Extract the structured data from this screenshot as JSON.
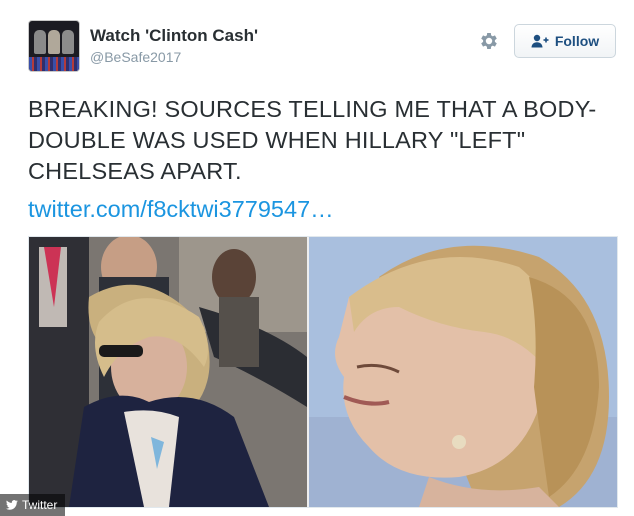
{
  "user": {
    "display_name": "Watch 'Clinton Cash'",
    "handle": "@BeSafe2017",
    "avatar_icon": "user-avatar"
  },
  "actions": {
    "follow_label": "Follow",
    "follow_icon": "person-plus-icon",
    "settings_icon": "gear-icon"
  },
  "tweet": {
    "text": "BREAKING! SOURCES TELLING ME THAT A BODY-DOUBLE WAS USED WHEN HILLARY \"LEFT\" CHELSEAS APART.",
    "link": "twitter.com/f8cktwi3779547…"
  },
  "media": {
    "photos": [
      "left-photo",
      "right-photo"
    ]
  },
  "watermark": {
    "label": "Twitter"
  },
  "colors": {
    "link": "#1b95e0",
    "follow_text": "#1d4f80",
    "text": "#292f33",
    "handle": "#8899a6"
  }
}
